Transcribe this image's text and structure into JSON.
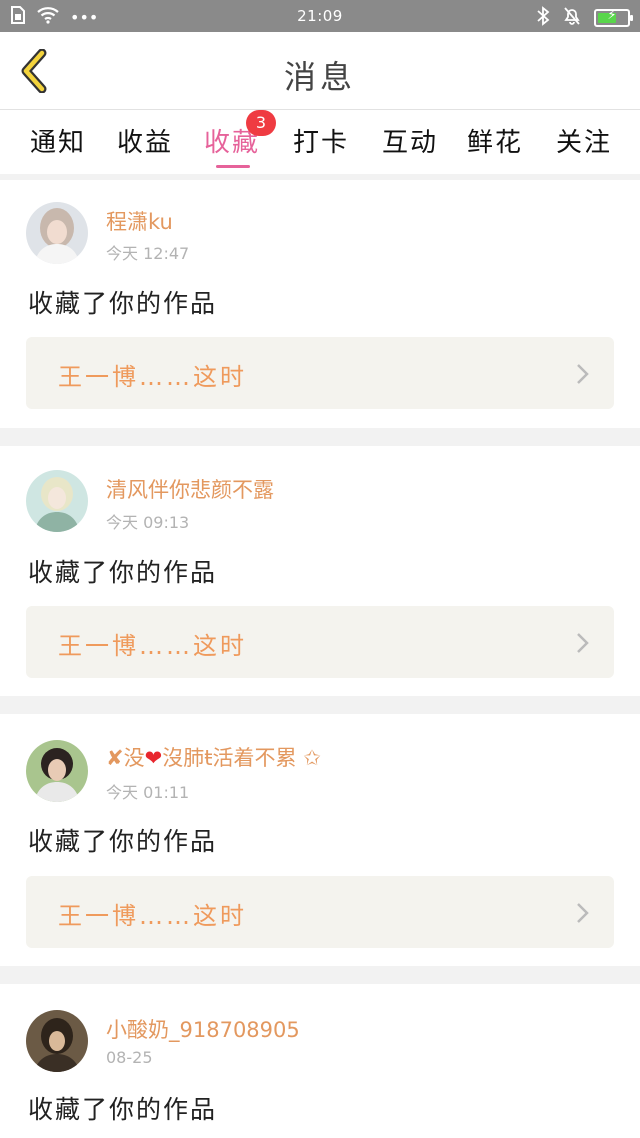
{
  "status_bar": {
    "time": "21:09",
    "dots": "•••"
  },
  "header": {
    "title": "消息"
  },
  "tabs": [
    {
      "label": "通知"
    },
    {
      "label": "收益"
    },
    {
      "label": "收藏",
      "badge": "3"
    },
    {
      "label": "打卡"
    },
    {
      "label": "互动"
    },
    {
      "label": "鲜花"
    },
    {
      "label": "关注"
    }
  ],
  "feed": [
    {
      "username": "程潇ku",
      "time": "今天 12:47",
      "action": "收藏了你的作品",
      "work": "王一博……这时"
    },
    {
      "username": "清风伴你悲颜不露",
      "time": "今天 09:13",
      "action": "收藏了你的作品",
      "work": "王一博……这时"
    },
    {
      "username_prefix": "✘没",
      "username_heart": "❤",
      "username_suffix": "沒肺ŧ活着不累 ✩",
      "time": "今天 01:11",
      "action": "收藏了你的作品",
      "work": "王一博……这时"
    },
    {
      "username": "小酸奶_918708905",
      "time": "08-25",
      "action": "收藏了你的作品"
    }
  ],
  "colors": {
    "accent_pink": "#e6629a",
    "username_orange": "#e3985f",
    "badge_red": "#ef3b42",
    "card_link_bg": "#f4f3ee",
    "status_bar_gray": "#8a8a8a"
  }
}
